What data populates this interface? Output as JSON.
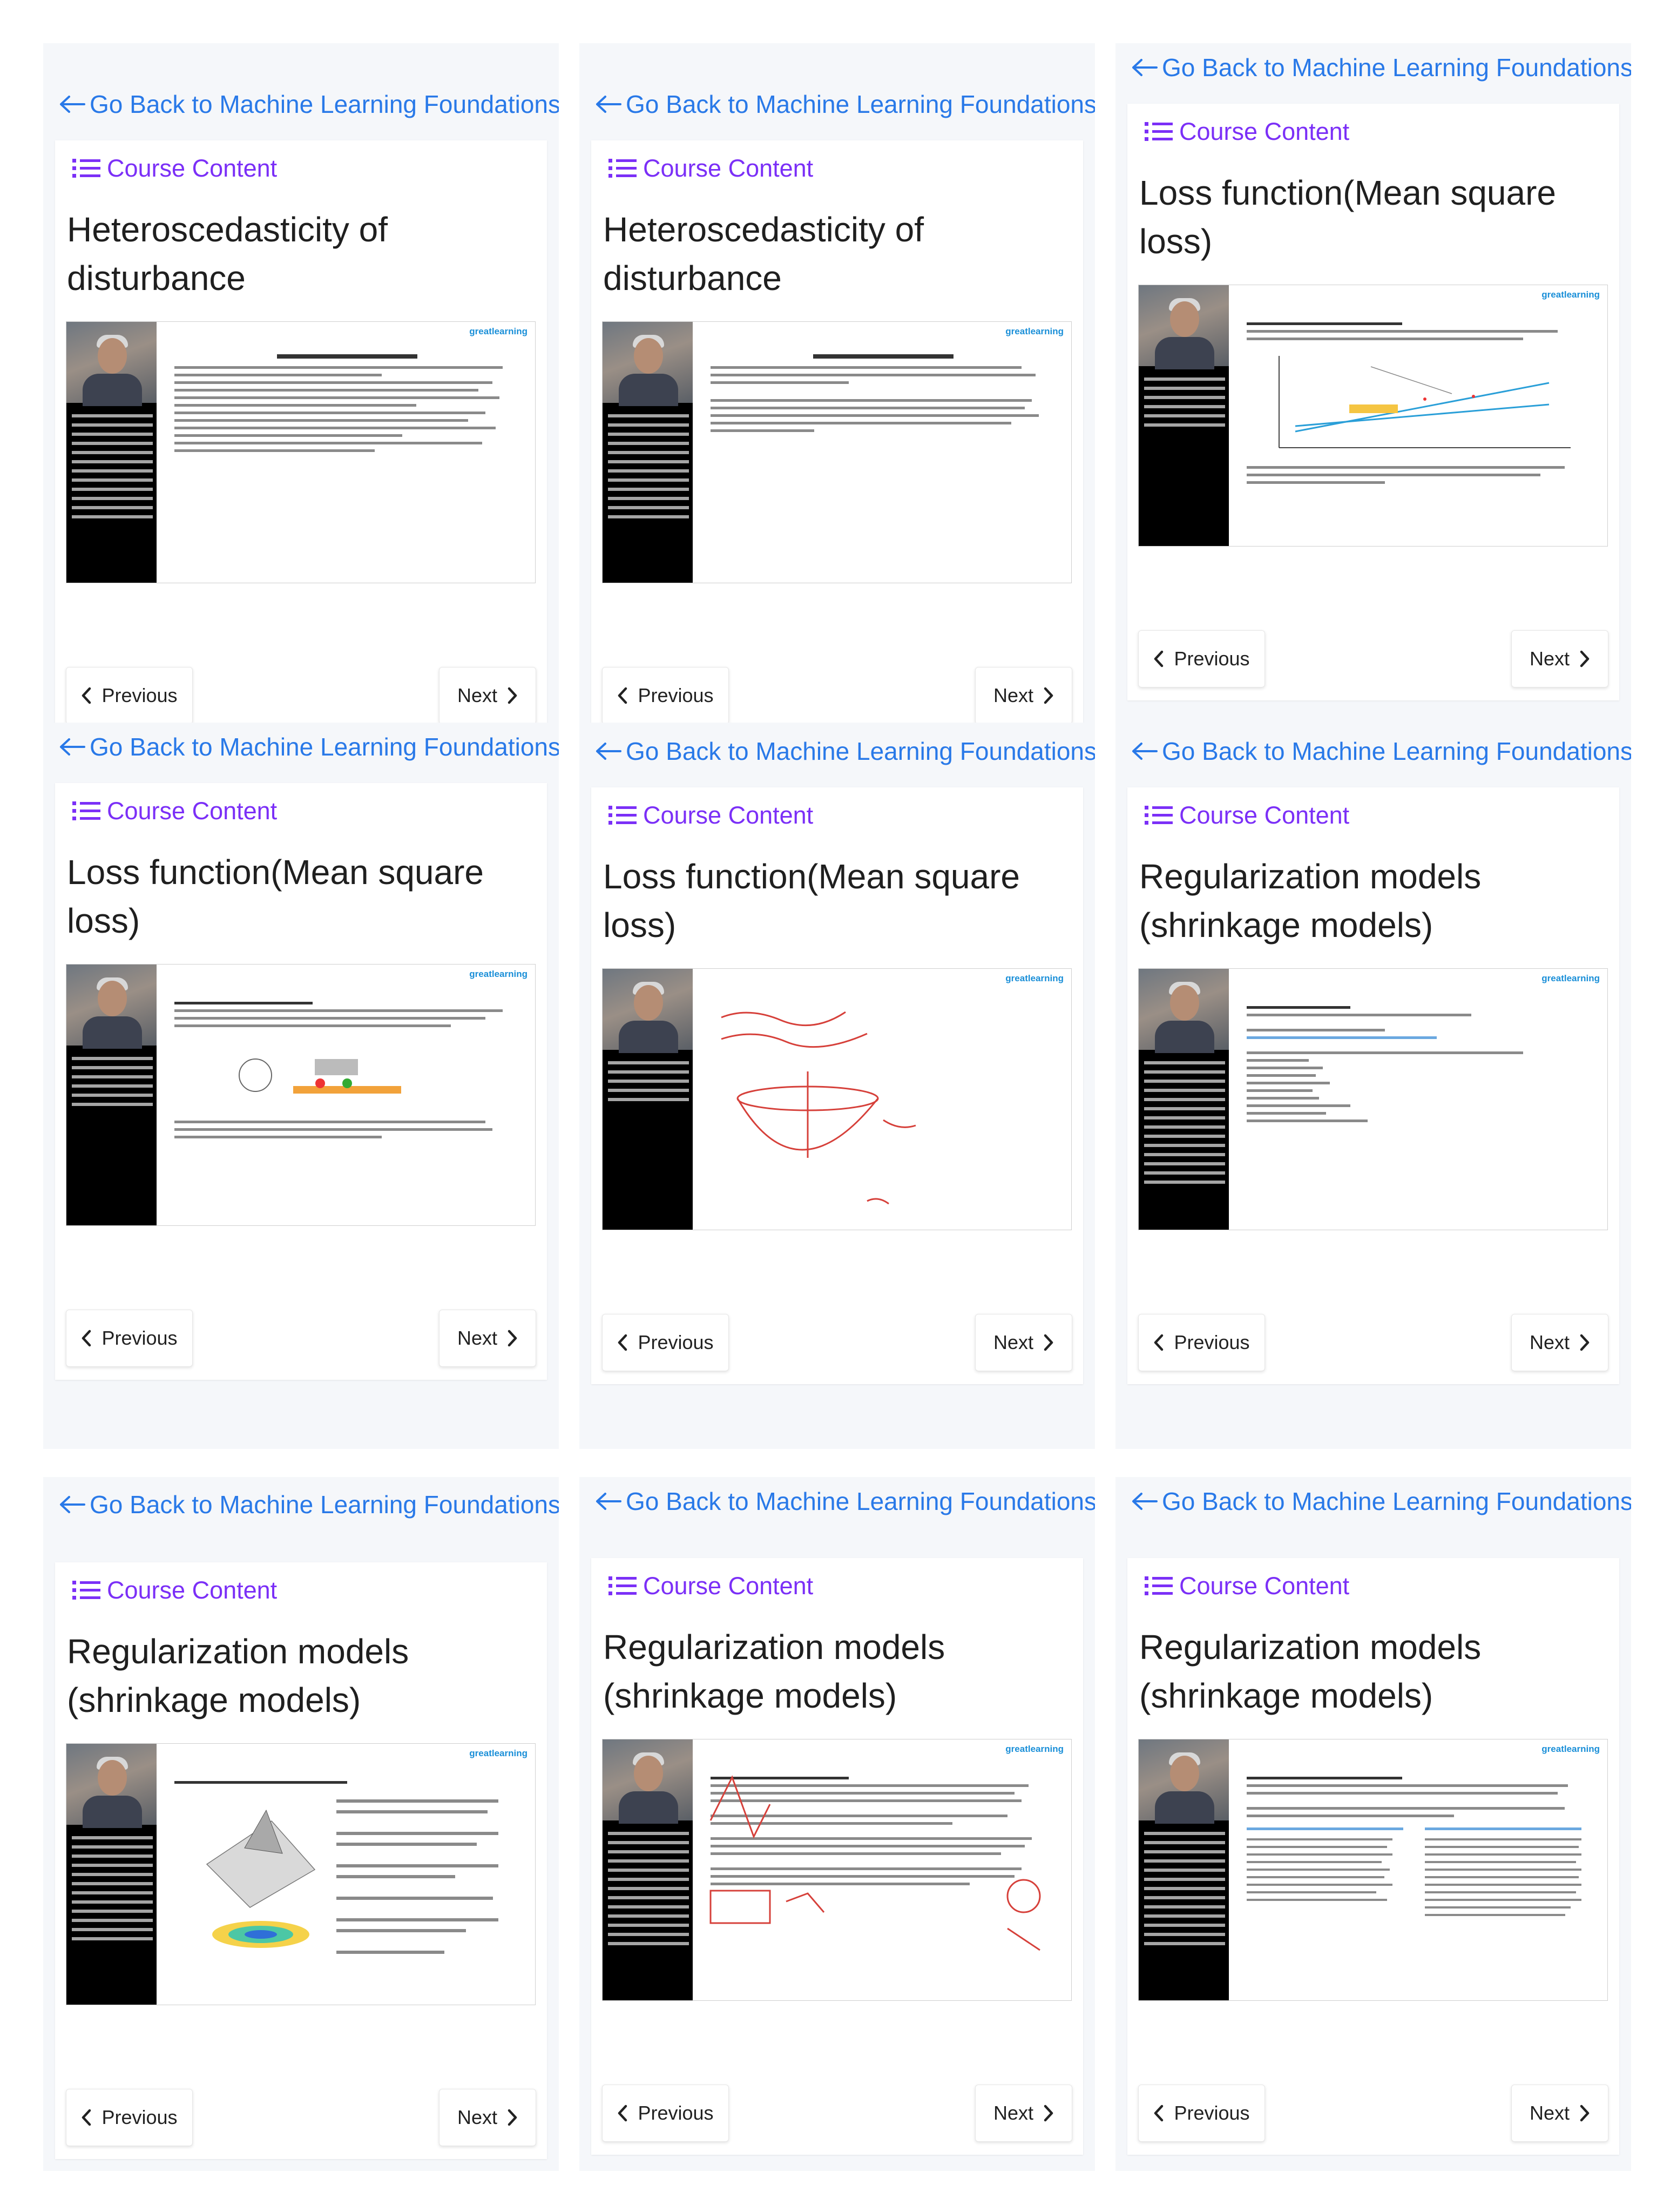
{
  "panels": [
    {
      "back_label": "Go Back to Machine Learning Foundations",
      "course_content_label": "Course Content",
      "lesson_title": "Heteroscedasticity of disturbance",
      "prev_label": "Previous",
      "next_label": "Next"
    },
    {
      "back_label": "Go Back to Machine Learning Foundations",
      "course_content_label": "Course Content",
      "lesson_title": "Heteroscedasticity of disturbance",
      "prev_label": "Previous",
      "next_label": "Next"
    },
    {
      "back_label": "Go Back to Machine Learning Foundations",
      "course_content_label": "Course Content",
      "lesson_title": "Loss function(Mean square loss)",
      "prev_label": "Previous",
      "next_label": "Next"
    },
    {
      "back_label": "Go Back to Machine Learning Foundations",
      "course_content_label": "Course Content",
      "lesson_title": "Loss function(Mean square loss)",
      "prev_label": "Previous",
      "next_label": "Next"
    },
    {
      "back_label": "Go Back to Machine Learning Foundations",
      "course_content_label": "Course Content",
      "lesson_title": "Loss function(Mean square loss)",
      "prev_label": "Previous",
      "next_label": "Next"
    },
    {
      "back_label": "Go Back to Machine Learning Foundations",
      "course_content_label": "Course Content",
      "lesson_title": "Regularization models (shrinkage models)",
      "prev_label": "Previous",
      "next_label": "Next"
    },
    {
      "back_label": "Go Back to Machine Learning Foundations",
      "course_content_label": "Course Content",
      "lesson_title": "Regularization models (shrinkage models)",
      "prev_label": "Previous",
      "next_label": "Next"
    },
    {
      "back_label": "Go Back to Machine Learning Foundations",
      "course_content_label": "Course Content",
      "lesson_title": "Regularization models (shrinkage models)",
      "prev_label": "Previous",
      "next_label": "Next"
    },
    {
      "back_label": "Go Back to Machine Learning Foundations",
      "course_content_label": "Course Content",
      "lesson_title": "Regularization models (shrinkage models)",
      "prev_label": "Previous",
      "next_label": "Next"
    }
  ],
  "video_brand": "greatlearning",
  "colors": {
    "link": "#2979e8",
    "course_content": "#7b2ff7",
    "panel_bg": "#f5f7fa",
    "brand": "#1a8fd8"
  },
  "icons": {
    "back": "arrow-left-icon",
    "course_content": "list-icon",
    "prev": "chevron-left-icon",
    "next": "chevron-right-icon"
  }
}
